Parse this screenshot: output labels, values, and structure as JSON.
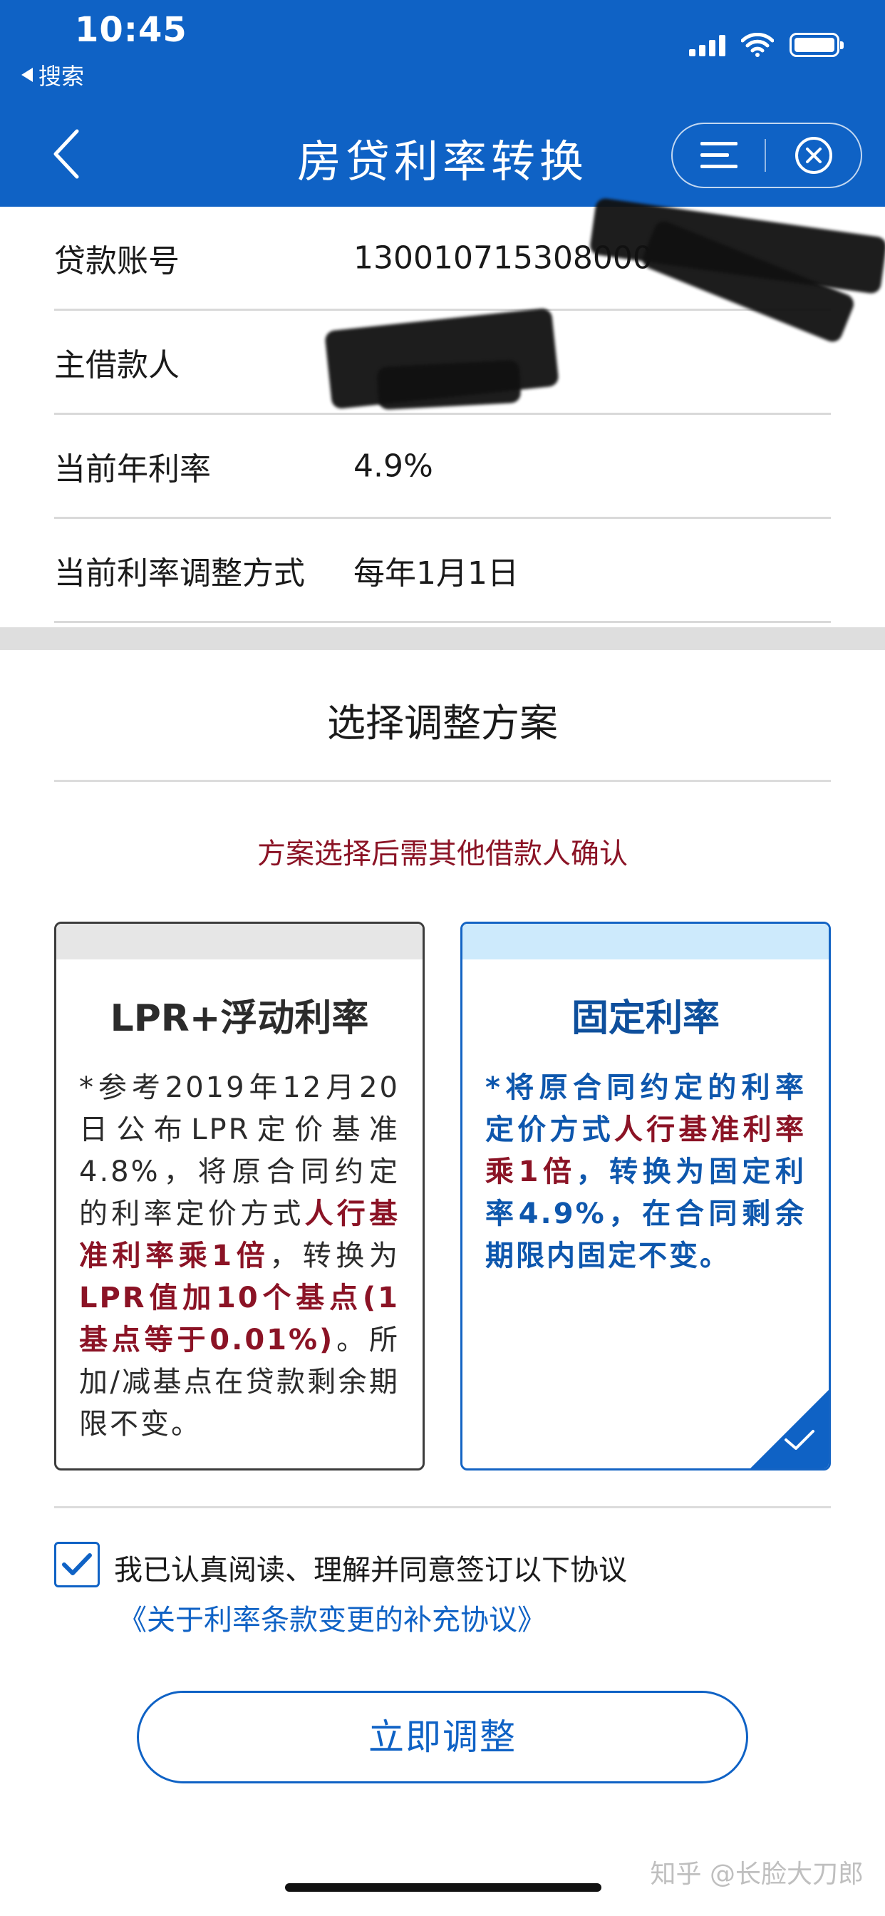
{
  "status_bar": {
    "time": "10:45",
    "back_app": "搜索"
  },
  "nav": {
    "title": "房贷利率转换"
  },
  "info_rows": [
    {
      "label": "贷款账号",
      "value": "130010715308000"
    },
    {
      "label": "主借款人",
      "value": ""
    },
    {
      "label": "当前年利率",
      "value": "4.9%"
    },
    {
      "label": "当前利率调整方式",
      "value": "每年1月1日"
    }
  ],
  "plan": {
    "title": "选择调整方案",
    "notice": "方案选择后需其他借款人确认",
    "options": [
      {
        "title": "LPR+浮动利率",
        "desc_parts": [
          "*参考2019年12月20日公布LPR定价基准4.8%，将原合同约定的利率定价方式",
          "人行基准利率乘1倍",
          "，转换为",
          "LPR值加10个基点(1基点等于0.01%)",
          "。所加/减基点在贷款剩余期限不变。"
        ]
      },
      {
        "title": "固定利率",
        "desc_parts": [
          "*将原合同约定的利率定价方式",
          "人行基准利率乘1倍",
          "，转换为固定利率4.9%，在合同剩余期限内固定不变。"
        ],
        "selected": true
      }
    ]
  },
  "agreement": {
    "text": "我已认真阅读、理解并同意签订以下协议",
    "link": "《关于利率条款变更的补充协议》",
    "checked": true
  },
  "submit_label": "立即调整",
  "watermark": "知乎 @长脸大刀郎",
  "colors": {
    "primary": "#0f62c5",
    "highlight": "#8b1325",
    "fixed_text": "#0e57ad"
  },
  "icons": [
    "chevron-left-icon",
    "menu-icon",
    "close-circle-icon",
    "signal-icon",
    "wifi-icon",
    "battery-icon",
    "checkmark-icon"
  ]
}
